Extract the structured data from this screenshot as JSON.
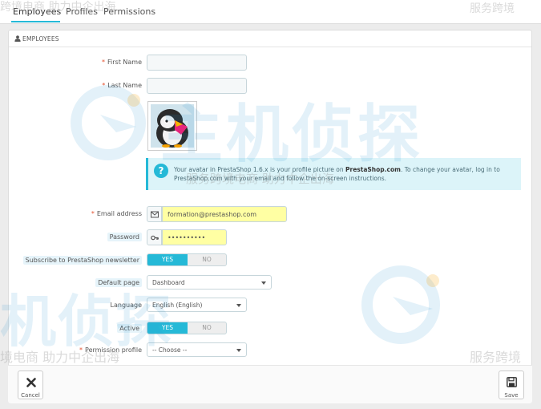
{
  "tabs": [
    {
      "label": "Employees"
    },
    {
      "label": "Profiles"
    },
    {
      "label": "Permissions"
    }
  ],
  "panel": {
    "title": "EMPLOYEES"
  },
  "form": {
    "first_name": {
      "label": "First Name",
      "value": ""
    },
    "last_name": {
      "label": "Last Name",
      "value": ""
    },
    "avatar_info": {
      "prefix": "Your avatar in PrestaShop 1.6.x is your profile picture on ",
      "link": "PrestaShop.com",
      "suffix": ". To change your avatar, log in to PrestaShop.com with your email and follow the on-screen instructions."
    },
    "email": {
      "label": "Email address",
      "value": "formation@prestashop.com"
    },
    "password": {
      "label": "Password",
      "value": "••••••••••"
    },
    "newsletter": {
      "label": "Subscribe to PrestaShop newsletter",
      "yes": "YES",
      "no": "NO"
    },
    "default_page": {
      "label": "Default page",
      "value": "Dashboard"
    },
    "language": {
      "label": "Language",
      "value": "English (English)"
    },
    "active": {
      "label": "Active",
      "yes": "YES",
      "no": "NO"
    },
    "permission_profile": {
      "label": "Permission profile",
      "value": "-- Choose --"
    }
  },
  "footer": {
    "cancel": "Cancel",
    "save": "Save"
  },
  "watermark": {
    "brand": "主机侦探",
    "brand_small": "机侦探",
    "slogan": "跨境电商 助力中企出海",
    "slogan_short": "境电商 助力中企出海",
    "slogan_right": "服务跨境",
    "overlay_text": "服务跨境电商 助力中企出海"
  },
  "colors": {
    "accent": "#25b9d7",
    "required": "#e4502e",
    "autofill": "#ffffa3"
  }
}
